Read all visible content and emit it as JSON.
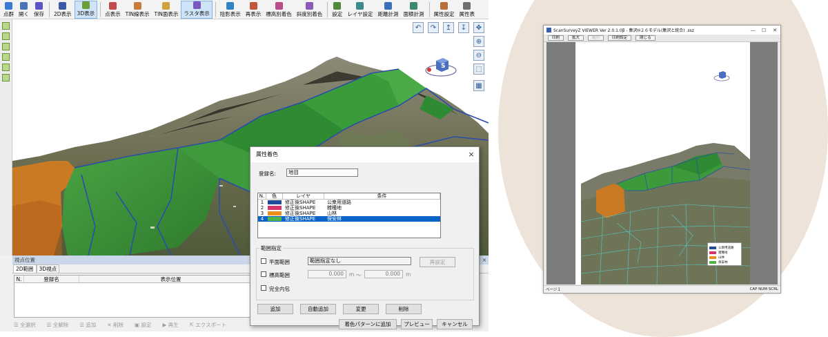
{
  "toolbar": {
    "items": [
      {
        "label": "点群",
        "icon": "point-cloud-icon",
        "color": "#3b7bd1"
      },
      {
        "label": "開く",
        "icon": "open-icon",
        "color": "#4a74b6"
      },
      {
        "label": "保存",
        "icon": "save-icon",
        "color": "#5a54c4"
      },
      {
        "label": "2D表示",
        "icon": "view-2d-icon",
        "color": "#3a5aa8"
      },
      {
        "label": "3D表示",
        "icon": "view-3d-icon",
        "color": "#6a9e3b",
        "active": true
      },
      {
        "label": "点表示",
        "icon": "point-display-icon",
        "color": "#c24b4b"
      },
      {
        "label": "TIN線表示",
        "icon": "tin-line-icon",
        "color": "#c87a3b"
      },
      {
        "label": "TIN面表示",
        "icon": "tin-face-icon",
        "color": "#d0a23c"
      },
      {
        "label": "ラスタ表示",
        "icon": "raster-icon",
        "color": "#7a56c0",
        "active": true
      },
      {
        "label": "陰影表示",
        "icon": "shade-icon",
        "color": "#2f83c5"
      },
      {
        "label": "再表示",
        "icon": "refresh-icon",
        "color": "#c0563b"
      },
      {
        "label": "標高別着色",
        "icon": "elevation-color-icon",
        "color": "#b84d8a"
      },
      {
        "label": "斜度別着色",
        "icon": "slope-color-icon",
        "color": "#8a5bb8"
      },
      {
        "label": "設定",
        "icon": "settings-icon",
        "color": "#4f8a3c"
      },
      {
        "label": "レイヤ設定",
        "icon": "layer-settings-icon",
        "color": "#3c8a8a"
      },
      {
        "label": "距離計測",
        "icon": "distance-measure-icon",
        "color": "#3b6fb8"
      },
      {
        "label": "面積計測",
        "icon": "area-measure-icon",
        "color": "#3b8a6f"
      },
      {
        "label": "属性設定",
        "icon": "attribute-settings-icon",
        "color": "#b86e3b"
      },
      {
        "label": "属性表",
        "icon": "attribute-table-icon",
        "color": "#6e6e6e"
      }
    ]
  },
  "position_panel": {
    "title": "視点位置",
    "close": "×",
    "tabs": [
      "2D範囲",
      "3D視点"
    ],
    "columns": [
      "N.",
      "登録名",
      "表示位置"
    ],
    "footer": [
      "全選択",
      "全解除",
      "追加",
      "削除",
      "設定",
      "再生",
      "エクスポート"
    ]
  },
  "dialog": {
    "title": "属性着色",
    "close": "×",
    "reg_name_label": "登録名:",
    "reg_name_value": "地目",
    "list_headers": [
      "N.",
      "色",
      "レイヤ",
      "条件"
    ],
    "rows": [
      {
        "n": "1",
        "color": "#214b9a",
        "layer": "修正後SHAPE",
        "condition": "公衆用道路",
        "selected": false
      },
      {
        "n": "2",
        "color": "#d6336c",
        "layer": "修正後SHAPE",
        "condition": "雑種地",
        "selected": false
      },
      {
        "n": "3",
        "color": "#ef8c1e",
        "layer": "修正後SHAPE",
        "condition": "山林",
        "selected": false
      },
      {
        "n": "4",
        "color": "#4fb34a",
        "layer": "修正後SHAPE",
        "condition": "保安林",
        "selected": true
      }
    ],
    "range_group_label": "範囲指定",
    "plane_range_label": "平面範囲",
    "plane_range_value": "範囲指定なし",
    "reset_button": "再設定",
    "elev_range_label": "標高範囲",
    "elev_min": "0.000",
    "elev_max": "0.000",
    "unit_m": "m",
    "tilde": "〜",
    "full_inside_label": "完全内包",
    "buttons": {
      "add": "追加",
      "auto_add": "自動追加",
      "change": "変更",
      "delete": "削除",
      "add_pattern": "着色パターンに追加",
      "preview": "プレビュー",
      "cancel": "キャンセル"
    }
  },
  "viewer": {
    "title": "ScanSurveyZ VIEWER  Ver 2.0.1.0β - 集沢H２６モデル(集沢と統合) .ssz",
    "minimize": "—",
    "maximize": "☐",
    "close": "✕",
    "toolbar": [
      {
        "label": "印刷",
        "disabled": false
      },
      {
        "label": "拡大",
        "disabled": false
      },
      {
        "label": "縮小",
        "disabled": true
      },
      {
        "label": "印刷設定",
        "disabled": false
      },
      {
        "label": "閉じる",
        "disabled": false
      }
    ],
    "status_left": "ページ１",
    "status_right": "CAP NUM SCRL",
    "legend": [
      {
        "label": "公衆用道路",
        "color": "#214b9a"
      },
      {
        "label": "雑種地",
        "color": "#d6336c"
      },
      {
        "label": "山林",
        "color": "#ef8c1e"
      },
      {
        "label": "保安林",
        "color": "#4fb34a"
      }
    ]
  },
  "colors": {
    "accent_blue": "#0a64c8",
    "forest_green": "#3f8f3a",
    "orange_parcel": "#c97a22",
    "circle_bg": "#ede3d9"
  }
}
